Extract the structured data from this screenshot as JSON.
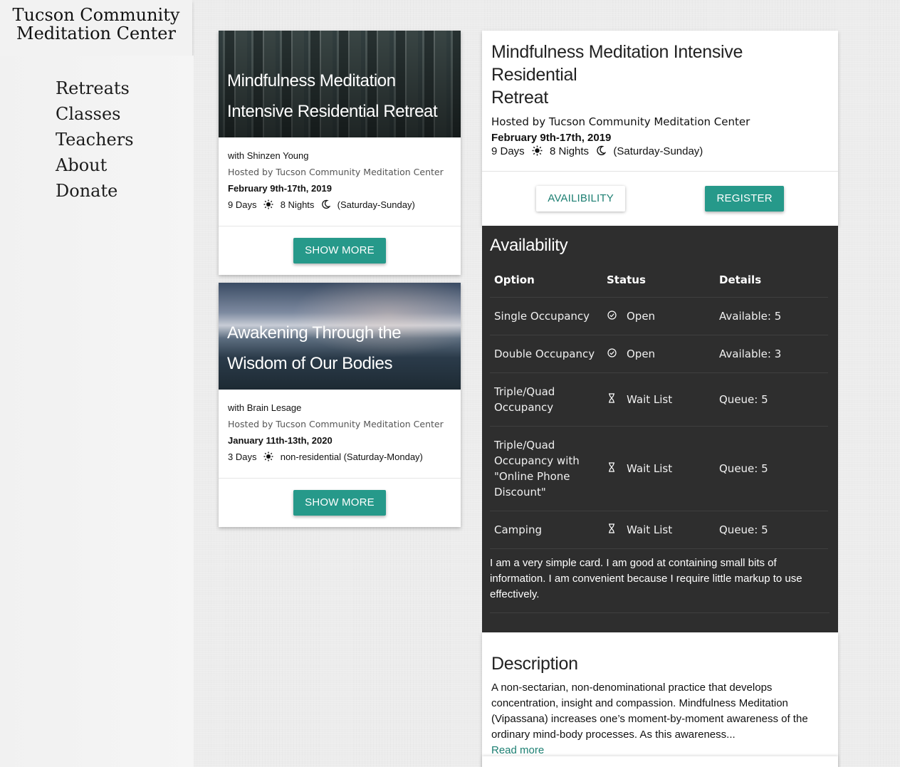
{
  "site": {
    "title_line1": "Tucson Community",
    "title_line2": "Meditation Center"
  },
  "nav": {
    "items": [
      "Retreats",
      "Classes",
      "Teachers",
      "About",
      "Donate"
    ]
  },
  "cards": [
    {
      "title_line1": "Mindfulness Meditation",
      "title_line2": "Intensive Residential Retreat",
      "teacher": "with Shinzen Young",
      "hosted_prefix": "Hosted by",
      "host": "Tucson Community Meditation Center",
      "dates": "February 9th-17th, 2019",
      "days": "9 Days",
      "nights": "8 Nights",
      "range": "(Saturday-Sunday)",
      "button": "SHOW MORE"
    },
    {
      "title_line1": "Awakening Through the",
      "title_line2": "Wisdom of Our Bodies",
      "teacher": "with Brain Lesage",
      "hosted_prefix": "Hosted by",
      "host": "Tucson Community Meditation Center",
      "dates": "January 11th-13th, 2020",
      "days": "3 Days",
      "range": "non-residential (Saturday-Monday)",
      "button": "SHOW MORE"
    }
  ],
  "detail": {
    "title_line1": "Mindfulness Meditation Intensive Residential",
    "title_line2": "Retreat",
    "hosted_prefix": "Hosted by",
    "host": "Tucson Community Meditation Center",
    "dates": "February 9th-17th, 2019",
    "days": "9 Days",
    "nights": "8 Nights",
    "range": "(Saturday-Sunday)",
    "availability_button": "AVAILIBILITY",
    "register_button": "REGISTER"
  },
  "availability": {
    "title": "Availability",
    "headers": [
      "Option",
      "Status",
      "Details"
    ],
    "rows": [
      {
        "option": "Single Occupancy",
        "status_icon": "check-circle-icon",
        "status": "Open",
        "details": "Available: 5"
      },
      {
        "option": "Double Occupancy",
        "status_icon": "check-circle-icon",
        "status": "Open",
        "details": "Available: 3"
      },
      {
        "option": "Triple/Quad Occupancy",
        "status_icon": "hourglass-icon",
        "status": "Wait List",
        "details": "Queue: 5"
      },
      {
        "option": "Triple/Quad Occupancy with \"Online Phone Discount\"",
        "status_icon": "hourglass-icon",
        "status": "Wait List",
        "details": "Queue: 5"
      },
      {
        "option": "Camping",
        "status_icon": "hourglass-icon",
        "status": "Wait List",
        "details": "Queue: 5"
      }
    ],
    "note": "I am a very simple card. I am good at containing small bits of information. I am convenient because I require little markup to use effectively."
  },
  "description": {
    "title": "Description",
    "text": "A non-sectarian, non-denominational practice that develops concentration, insight and compassion. Mindfulness Meditation (Vipassana) increases one’s moment-by-moment awareness of the ordinary mind-body processes. As this awareness...",
    "read_more": "Read more"
  },
  "colors": {
    "accent": "#26998a",
    "accent_text": "#1c7f72",
    "dark_panel": "#2e2e2e"
  }
}
